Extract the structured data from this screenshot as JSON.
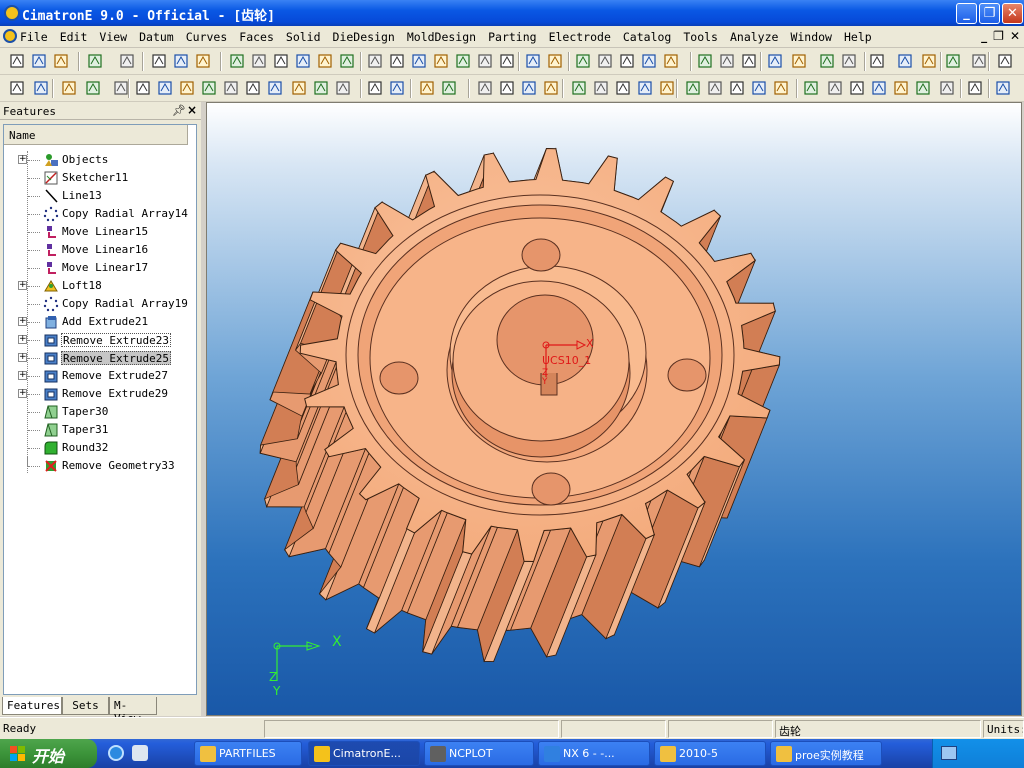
{
  "window": {
    "title": "CimatronE 9.0 - Official - [齿轮]"
  },
  "menu": [
    "File",
    "Edit",
    "View",
    "Datum",
    "Curves",
    "Faces",
    "Solid",
    "DieDesign",
    "MoldDesign",
    "Parting",
    "Electrode",
    "Catalog",
    "Tools",
    "Analyze",
    "Window",
    "Help"
  ],
  "features_panel": {
    "title": "Features",
    "column_header": "Name",
    "items": [
      {
        "label": "Objects",
        "icon": "objects-icon",
        "expandable": true
      },
      {
        "label": "Sketcher11",
        "icon": "sketcher-icon",
        "expandable": false
      },
      {
        "label": "Line13",
        "icon": "line-icon",
        "expandable": false
      },
      {
        "label": "Copy Radial Array14",
        "icon": "radial-array-icon",
        "expandable": false
      },
      {
        "label": "Move Linear15",
        "icon": "move-linear-icon",
        "expandable": false
      },
      {
        "label": "Move Linear16",
        "icon": "move-linear-icon",
        "expandable": false
      },
      {
        "label": "Move Linear17",
        "icon": "move-linear-icon",
        "expandable": false
      },
      {
        "label": "Loft18",
        "icon": "loft-icon",
        "expandable": true
      },
      {
        "label": "Copy Radial Array19",
        "icon": "radial-array-icon",
        "expandable": false
      },
      {
        "label": "Add Extrude21",
        "icon": "add-extrude-icon",
        "expandable": true
      },
      {
        "label": "Remove Extrude23",
        "icon": "remove-extrude-icon",
        "expandable": true,
        "state": "focused"
      },
      {
        "label": "Remove Extrude25",
        "icon": "remove-extrude-icon",
        "expandable": true,
        "state": "selected"
      },
      {
        "label": "Remove Extrude27",
        "icon": "remove-extrude-icon",
        "expandable": true
      },
      {
        "label": "Remove Extrude29",
        "icon": "remove-extrude-icon",
        "expandable": true
      },
      {
        "label": "Taper30",
        "icon": "taper-icon",
        "expandable": false
      },
      {
        "label": "Taper31",
        "icon": "taper-icon",
        "expandable": false
      },
      {
        "label": "Round32",
        "icon": "round-icon",
        "expandable": false
      },
      {
        "label": "Remove Geometry33",
        "icon": "remove-geometry-icon",
        "expandable": false
      }
    ],
    "tabs": [
      "Features",
      "Sets",
      "M-View"
    ]
  },
  "viewport": {
    "ucs_label": "UCS10_1",
    "axis_x": "X",
    "axis_y": "Y",
    "axis_z": "Z",
    "triad_x": "X",
    "triad_y": "Y",
    "triad_z": "Z",
    "part_color": "#f5a878",
    "gear_teeth": 24
  },
  "statusbar": {
    "status": "Ready",
    "file": "齿轮",
    "units_label": "Units:"
  },
  "taskbar": {
    "start": "开始",
    "tasks": [
      "PARTFILES",
      "CimatronE...",
      "NCPLOT",
      "NX 6 - -...",
      "2010-5",
      "proe实例教程"
    ]
  },
  "colors": {
    "titlebar": "#0a58e4",
    "viewport_top": "#ffffff",
    "viewport_bottom": "#1958a8",
    "part": "#f5a878",
    "part_shadow": "#c8744a"
  }
}
